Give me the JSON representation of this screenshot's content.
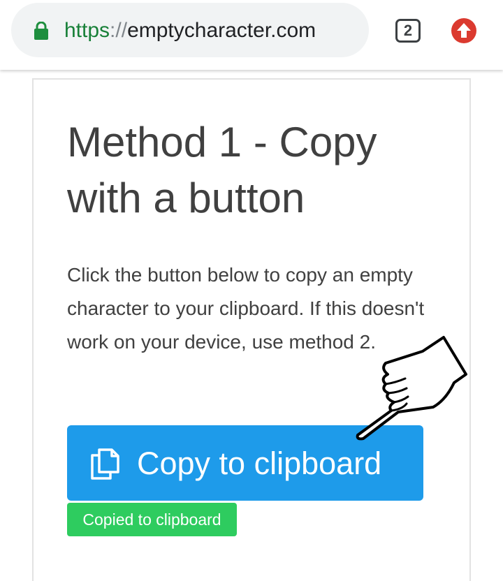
{
  "browser": {
    "url_scheme": "https",
    "url_separator": "://",
    "url_host": "emptycharacter.com",
    "tab_count": "2",
    "icons": {
      "lock": "lock-icon",
      "update": "update-arrow-icon"
    },
    "colors": {
      "lock": "#1e8e3e",
      "update": "#db3a2f"
    }
  },
  "main": {
    "title": "Method 1 - Copy with a button",
    "description": "Click the button below to copy an empty character to your clipboard. If this doesn't work on your device, use method 2.",
    "copy_button_label": "Copy to clipboard",
    "copied_status": "Copied to clipboard",
    "icons": {
      "copy": "copy-icon",
      "pointer": "hand-pointer-icon"
    },
    "colors": {
      "button": "#1e9bea",
      "status": "#2ecc5f"
    }
  }
}
